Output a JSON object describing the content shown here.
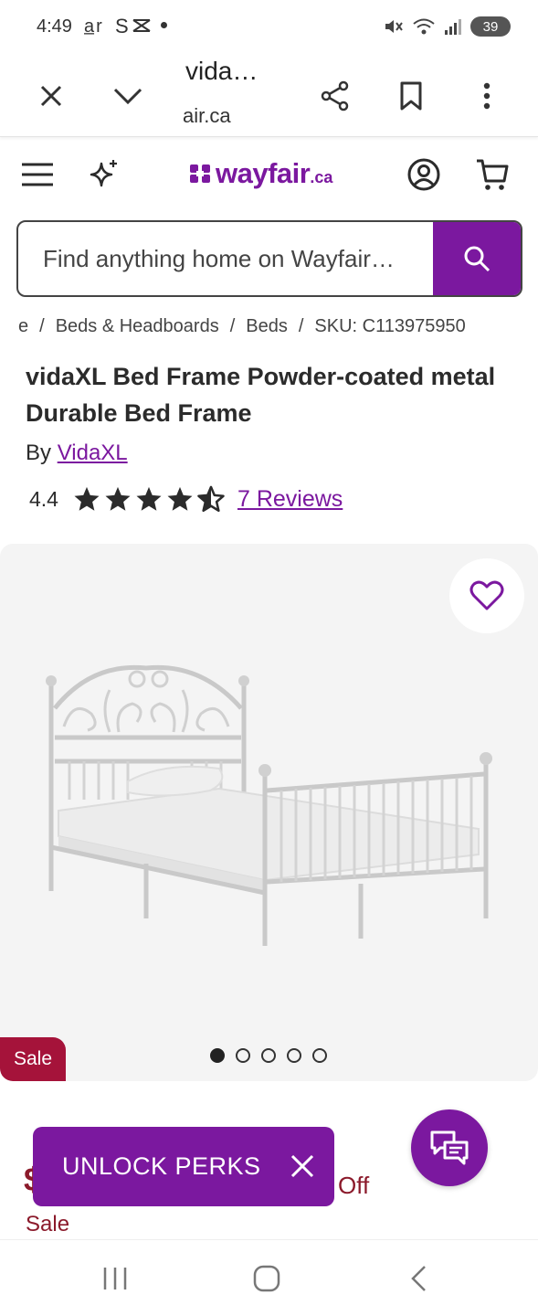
{
  "status": {
    "time": "4:49",
    "left_icons": "a͛r S ⨷",
    "battery": "39"
  },
  "browser": {
    "title": "vida…",
    "url_fade": "",
    "url": "air.ca"
  },
  "header": {
    "logo_word": "wayfair",
    "logo_tld": ".ca"
  },
  "search": {
    "placeholder": "Find anything home on Wayfair…"
  },
  "breadcrumb": {
    "items": [
      "e",
      "Beds & Headboards",
      "Beds",
      "SKU: C113975950"
    ],
    "separator": "/"
  },
  "product": {
    "title": "vidaXL Bed Frame Powder-coated metal Durable Bed Frame",
    "by_label": "By",
    "brand": "VidaXL",
    "rating": "4.4",
    "rating_value": 4.4,
    "reviews_label": "7 Reviews"
  },
  "gallery": {
    "sale_badge": "Sale",
    "image_count": 5,
    "active_index": 0
  },
  "promo": {
    "unlock_label": "UNLOCK PERKS",
    "price_peek": "Off",
    "price_symbol": "$",
    "sale_text": "Sale"
  },
  "colors": {
    "brand": "#7b189f",
    "sale": "#a5133a"
  }
}
